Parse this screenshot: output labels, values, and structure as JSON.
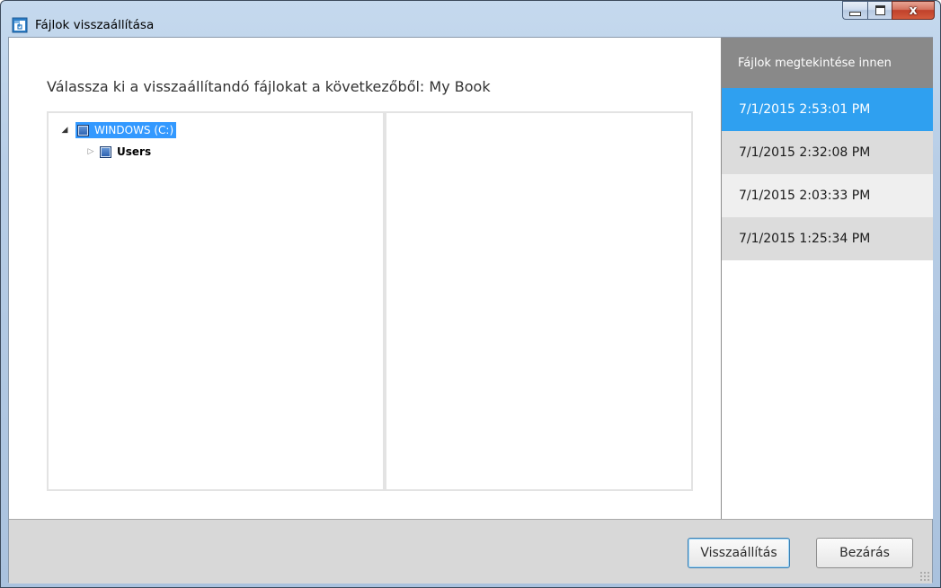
{
  "window": {
    "title": "Fájlok visszaállítása",
    "close_glyph": "x",
    "icons": [
      "restore-files-app-icon",
      "minimize-icon",
      "maximize-icon",
      "close-icon"
    ]
  },
  "main": {
    "heading": "Válassza ki a visszaállítandó fájlokat a következőből: My Book",
    "tree": [
      {
        "label": "WINDOWS (C:)",
        "expanded": true,
        "selected": true,
        "level": 0
      },
      {
        "label": "Users",
        "expanded": false,
        "selected": false,
        "level": 1
      }
    ],
    "expander_open": "◢",
    "expander_closed": "▷"
  },
  "sidebar": {
    "header": "Fájlok megtekintése innen",
    "snapshots": [
      {
        "label": "7/1/2015 2:53:01 PM",
        "selected": true
      },
      {
        "label": "7/1/2015 2:32:08 PM",
        "selected": false
      },
      {
        "label": "7/1/2015 2:03:33 PM",
        "selected": false
      },
      {
        "label": "7/1/2015 1:25:34 PM",
        "selected": false
      }
    ]
  },
  "footer": {
    "restore_label": "Visszaállítás",
    "close_label": "Bezárás"
  },
  "colors": {
    "selection_blue": "#3399ff",
    "snapshot_selected": "#2fa0f0",
    "sidebar_header_bg": "#898989",
    "footer_bg": "#d8d8d8"
  }
}
